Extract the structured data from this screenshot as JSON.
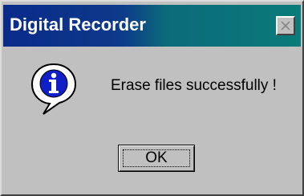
{
  "window": {
    "title": "Digital Recorder",
    "close_icon": "close-x-icon"
  },
  "dialog": {
    "icon": "info-icon",
    "message": "Erase files successfully !",
    "ok_label": "OK"
  },
  "colors": {
    "title_bar_start": "#0a2a8a",
    "title_bar_end": "#0a7a7a",
    "window_background": "#c0c0c0",
    "title_text": "#ffffff",
    "info_icon_blue": "#1020c8"
  }
}
